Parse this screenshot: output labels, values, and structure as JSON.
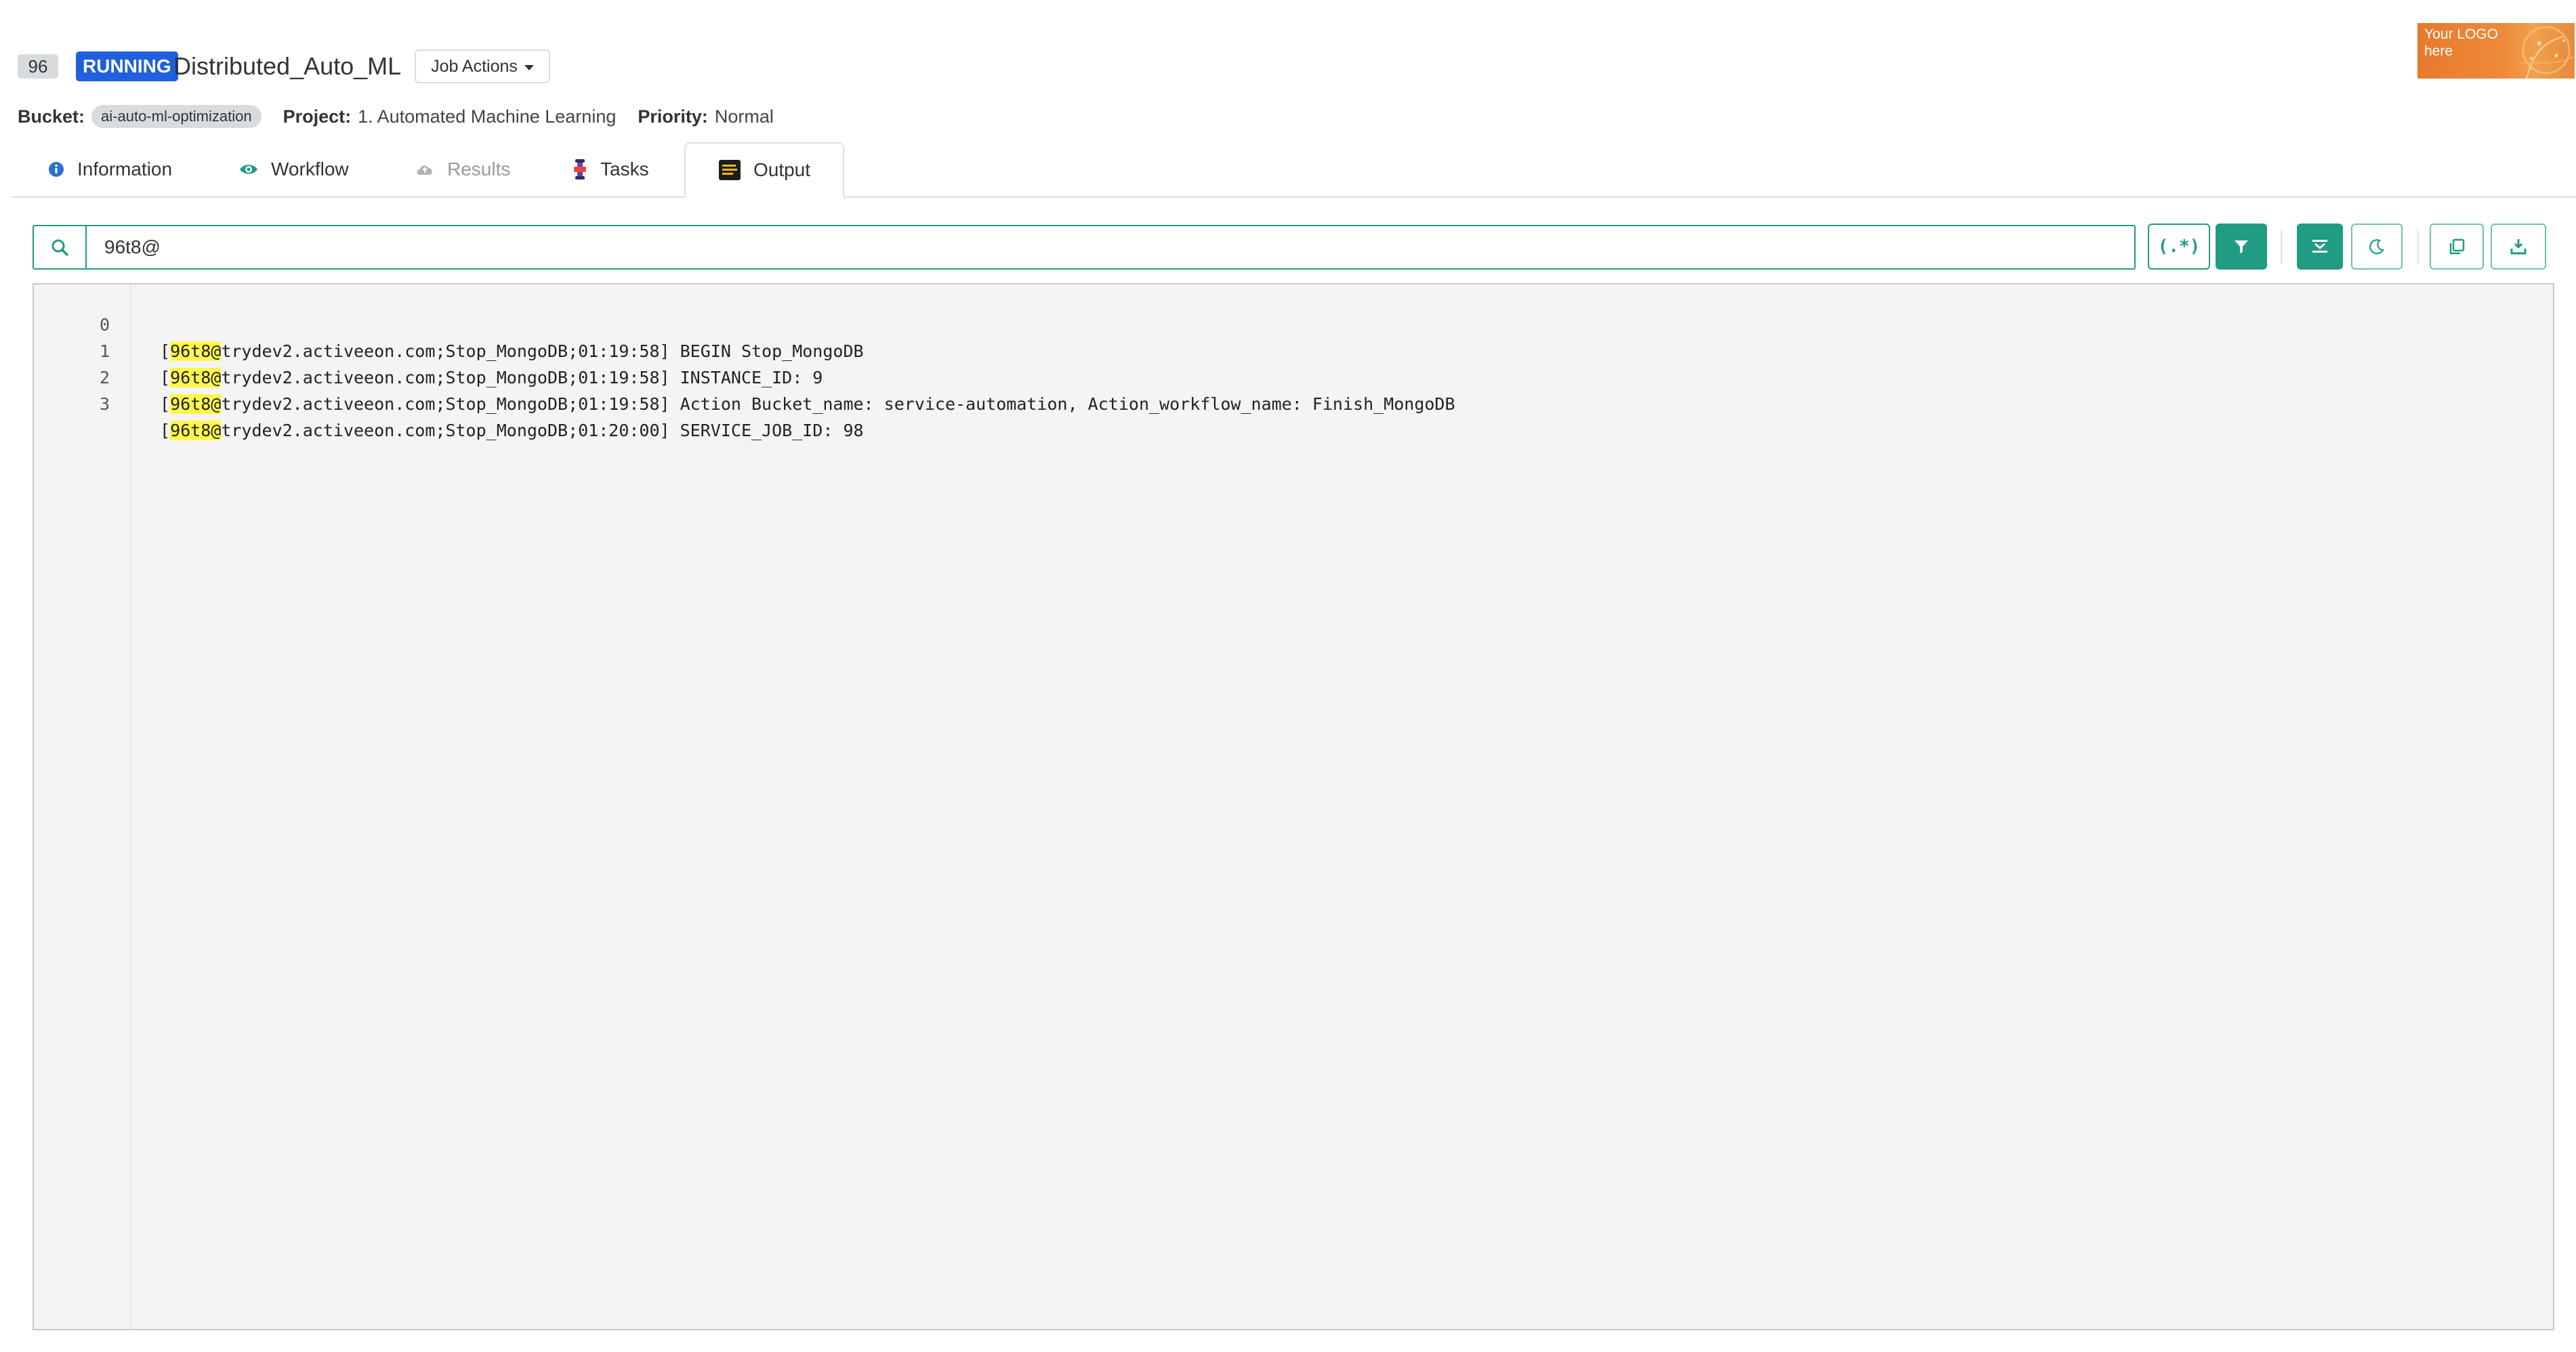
{
  "header": {
    "job_id": "96",
    "status": "RUNNING",
    "job_name": "Distributed_Auto_ML",
    "job_actions_label": "Job Actions"
  },
  "logo": {
    "text": "Your LOGO here"
  },
  "meta": {
    "bucket_label": "Bucket:",
    "bucket_value": "ai-auto-ml-optimization",
    "project_label": "Project:",
    "project_value": "1. Automated Machine Learning",
    "priority_label": "Priority:",
    "priority_value": "Normal"
  },
  "tabs": [
    {
      "label": "Information",
      "icon": "info-icon",
      "state": "normal"
    },
    {
      "label": "Workflow",
      "icon": "eye-icon",
      "state": "normal"
    },
    {
      "label": "Results",
      "icon": "cloud-icon",
      "state": "disabled"
    },
    {
      "label": "Tasks",
      "icon": "tasks-icon",
      "state": "normal"
    },
    {
      "label": "Output",
      "icon": "output-icon",
      "state": "active"
    }
  ],
  "search": {
    "value": "96t8@"
  },
  "toolbar": {
    "regex_label": "(.*)",
    "buttons": [
      "filter-icon",
      "scroll-to-bottom-icon",
      "dark-mode-moon-icon",
      "copy-icon",
      "download-icon"
    ]
  },
  "colors": {
    "accent": "#1f9c82",
    "running": "#1f5fe0",
    "highlight": "#fff74a",
    "logo": "#ef8a3a"
  },
  "log": {
    "highlight_term": "96t8@",
    "lines": [
      {
        "num": "0",
        "prefix": "[",
        "match": "96t8@",
        "rest": "trydev2.activeeon.com;Stop_MongoDB;01:19:58] BEGIN Stop_MongoDB"
      },
      {
        "num": "1",
        "prefix": "[",
        "match": "96t8@",
        "rest": "trydev2.activeeon.com;Stop_MongoDB;01:19:58] INSTANCE_ID: 9"
      },
      {
        "num": "2",
        "prefix": "[",
        "match": "96t8@",
        "rest": "trydev2.activeeon.com;Stop_MongoDB;01:19:58] Action Bucket_name: service-automation, Action_workflow_name: Finish_MongoDB"
      },
      {
        "num": "3",
        "prefix": "[",
        "match": "96t8@",
        "rest": "trydev2.activeeon.com;Stop_MongoDB;01:20:00] SERVICE_JOB_ID: 98"
      }
    ]
  }
}
